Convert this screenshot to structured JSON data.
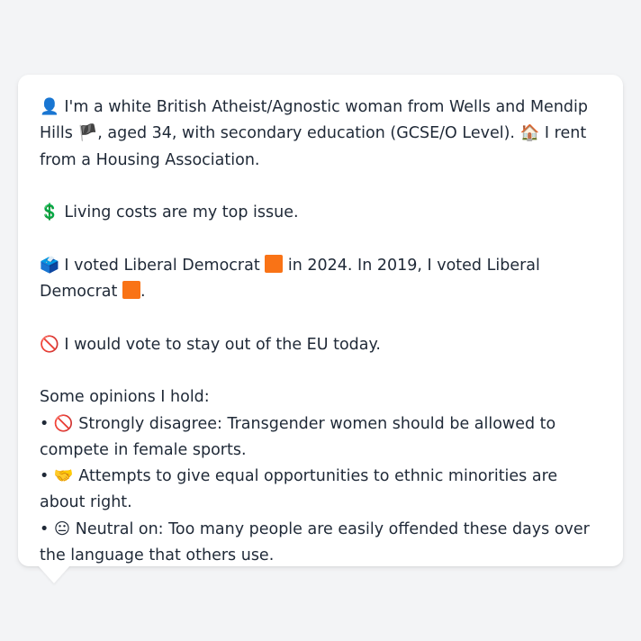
{
  "profile": {
    "line1_icon": "👤",
    "line1_text_a": "I'm a white British Atheist/Agnostic woman from Wells and Mendip Hills",
    "flag_icon": "🏴",
    "line1_text_b": ", aged 34, with secondary education (GCSE/O Level).",
    "house_icon": "🏠",
    "line1_text_c": "I rent from a Housing Association."
  },
  "issue": {
    "icon": "💲",
    "text": "Living costs are my top issue."
  },
  "vote": {
    "icon": "🗳️",
    "text_a": "I voted Liberal Democrat",
    "text_b": "in 2024. In 2019, I voted Liberal Democrat",
    "text_c": ".",
    "party_color": "#f97316"
  },
  "eu": {
    "icon": "🚫",
    "text": "I would vote to stay out of the EU today."
  },
  "opinions": {
    "heading": "Some opinions I hold:",
    "bullet": "•",
    "items": [
      {
        "icon": "🚫",
        "text": "Strongly disagree: Transgender women should be allowed to compete in female sports."
      },
      {
        "icon": "🤝",
        "text": "Attempts to give equal opportunities to ethnic minorities are about right."
      },
      {
        "icon": "😐",
        "text": "Neutral on: Too many people are easily offended these days over the language that others use."
      }
    ]
  }
}
